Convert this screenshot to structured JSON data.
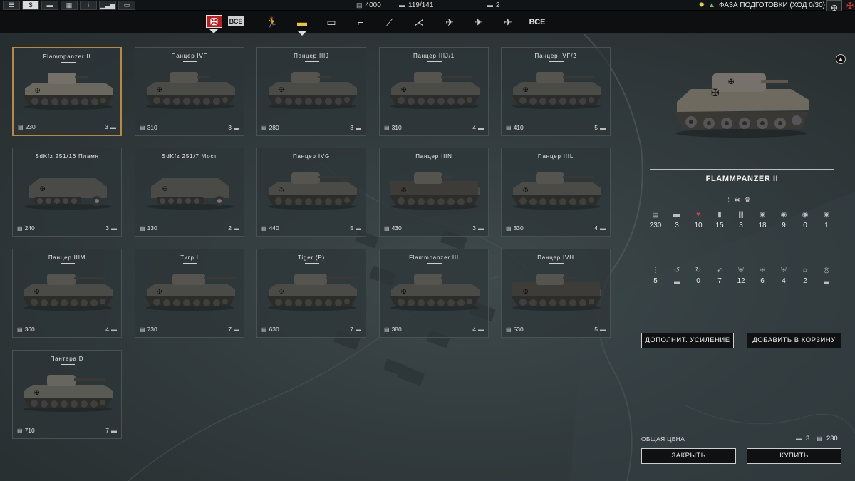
{
  "topbar": {
    "buttons": [
      {
        "icon": "hamburger-icon",
        "glyph": "☰"
      },
      {
        "icon": "dollar-icon",
        "glyph": "$"
      },
      {
        "icon": "chat-icon",
        "glyph": "▬"
      },
      {
        "icon": "grid-icon",
        "glyph": "▦"
      },
      {
        "icon": "info-icon",
        "glyph": "i"
      },
      {
        "icon": "stats-icon",
        "glyph": "▁▃▅"
      },
      {
        "icon": "screen-icon",
        "glyph": "▭"
      }
    ],
    "resources": {
      "money": "4000",
      "units": "119/141",
      "aircraft": "2"
    },
    "phase": "ФАЗА ПОДГОТОВКИ (ХОД 0/30)"
  },
  "filter": {
    "all_badge": "ВСЕ",
    "tabs": [
      {
        "name": "infantry",
        "icon": "infantry-icon",
        "glyph": "🏃"
      },
      {
        "name": "tanks",
        "icon": "tank-icon",
        "glyph": "▬",
        "active": true
      },
      {
        "name": "vehicles",
        "icon": "vehicle-icon",
        "glyph": "▭"
      },
      {
        "name": "anti-tank",
        "icon": "anti-tank-gun-icon",
        "glyph": "⌐"
      },
      {
        "name": "artillery",
        "icon": "artillery-icon",
        "glyph": "⟋"
      },
      {
        "name": "anti-air",
        "icon": "anti-air-icon",
        "glyph": "⋌"
      },
      {
        "name": "fighters",
        "icon": "fighter-icon",
        "glyph": "✈"
      },
      {
        "name": "attack-aircraft",
        "icon": "attack-aircraft-icon",
        "glyph": "✈"
      },
      {
        "name": "bombers",
        "icon": "bomber-icon",
        "glyph": "✈"
      }
    ],
    "all_label": "ВСЕ"
  },
  "units": [
    {
      "name": "Flammpanzer II",
      "cost": "230",
      "count": "3",
      "selected": true,
      "kind": "light"
    },
    {
      "name": "Панцер IVF",
      "cost": "310",
      "count": "3",
      "kind": "medium"
    },
    {
      "name": "Панцер IIIJ",
      "cost": "280",
      "count": "3",
      "kind": "medium"
    },
    {
      "name": "Панцер IIIJ/1",
      "cost": "310",
      "count": "4",
      "kind": "long"
    },
    {
      "name": "Панцер IVF/2",
      "cost": "410",
      "count": "5",
      "kind": "long"
    },
    {
      "name": "SdKfz 251/16 Пламя",
      "cost": "240",
      "count": "3",
      "kind": "halftrack"
    },
    {
      "name": "SdKfz 251/7 Мост",
      "cost": "130",
      "count": "2",
      "kind": "halftrack"
    },
    {
      "name": "Панцер IVG",
      "cost": "440",
      "count": "5",
      "kind": "long"
    },
    {
      "name": "Панцер IIIN",
      "cost": "430",
      "count": "3",
      "kind": "boxy"
    },
    {
      "name": "Панцер IIIL",
      "cost": "330",
      "count": "4",
      "kind": "long"
    },
    {
      "name": "Панцер IIIM",
      "cost": "360",
      "count": "4",
      "kind": "long"
    },
    {
      "name": "Тигр I",
      "cost": "730",
      "count": "7",
      "kind": "heavy"
    },
    {
      "name": "Tiger (P)",
      "cost": "630",
      "count": "7",
      "kind": "heavy"
    },
    {
      "name": "Flammpanzer III",
      "cost": "380",
      "count": "4",
      "kind": "medium"
    },
    {
      "name": "Панцер IVH",
      "cost": "530",
      "count": "5",
      "kind": "boxy"
    },
    {
      "name": "Пантера D",
      "cost": "710",
      "count": "7",
      "kind": "panther"
    }
  ],
  "detail": {
    "title": "FLAMMPANZER II",
    "stats_row1": [
      {
        "icon": "cost-icon",
        "glyph": "▤",
        "value": "230"
      },
      {
        "icon": "unit-count-icon",
        "glyph": "▬",
        "value": "3"
      },
      {
        "icon": "health-icon",
        "glyph": "♥",
        "value": "10",
        "red": true
      },
      {
        "icon": "ammo-icon",
        "glyph": "▮",
        "value": "15"
      },
      {
        "icon": "fuel-icon",
        "glyph": "|||",
        "value": "3"
      },
      {
        "icon": "soft-attack-icon",
        "glyph": "◉",
        "value": "18"
      },
      {
        "icon": "hard-attack-icon",
        "glyph": "◉",
        "value": "9"
      },
      {
        "icon": "air-attack-icon",
        "glyph": "◉",
        "value": "0"
      },
      {
        "icon": "naval-attack-icon",
        "glyph": "◉",
        "value": "1"
      }
    ],
    "stats_row2": [
      {
        "icon": "movement-icon",
        "glyph": "⋮",
        "value": "5"
      },
      {
        "icon": "move-type-icon",
        "glyph": "↺",
        "value": "▬",
        "is_icon": true
      },
      {
        "icon": "range-icon",
        "glyph": "↻",
        "value": "0"
      },
      {
        "icon": "spotting-icon",
        "glyph": "➶",
        "value": "7"
      },
      {
        "icon": "ground-defense-icon",
        "glyph": "⛨",
        "value": "12"
      },
      {
        "icon": "air-defense-icon",
        "glyph": "⛨",
        "value": "6"
      },
      {
        "icon": "close-defense-icon",
        "glyph": "⛨",
        "value": "4"
      },
      {
        "icon": "initiative-icon",
        "glyph": "⌂",
        "value": "2"
      },
      {
        "icon": "target-type-icon",
        "glyph": "◎",
        "value": "▬",
        "is_icon": true
      }
    ],
    "reinforce_button": "ДОПОЛНИТ. УСИЛЕНИЕ",
    "add_cart_button": "ДОБАВИТЬ В КОРЗИНУ",
    "total_label": "ОБЩАЯ ЦЕНА",
    "total_count": "3",
    "total_cost": "230",
    "close_button": "ЗАКРЫТЬ",
    "buy_button": "КУПИТЬ"
  }
}
